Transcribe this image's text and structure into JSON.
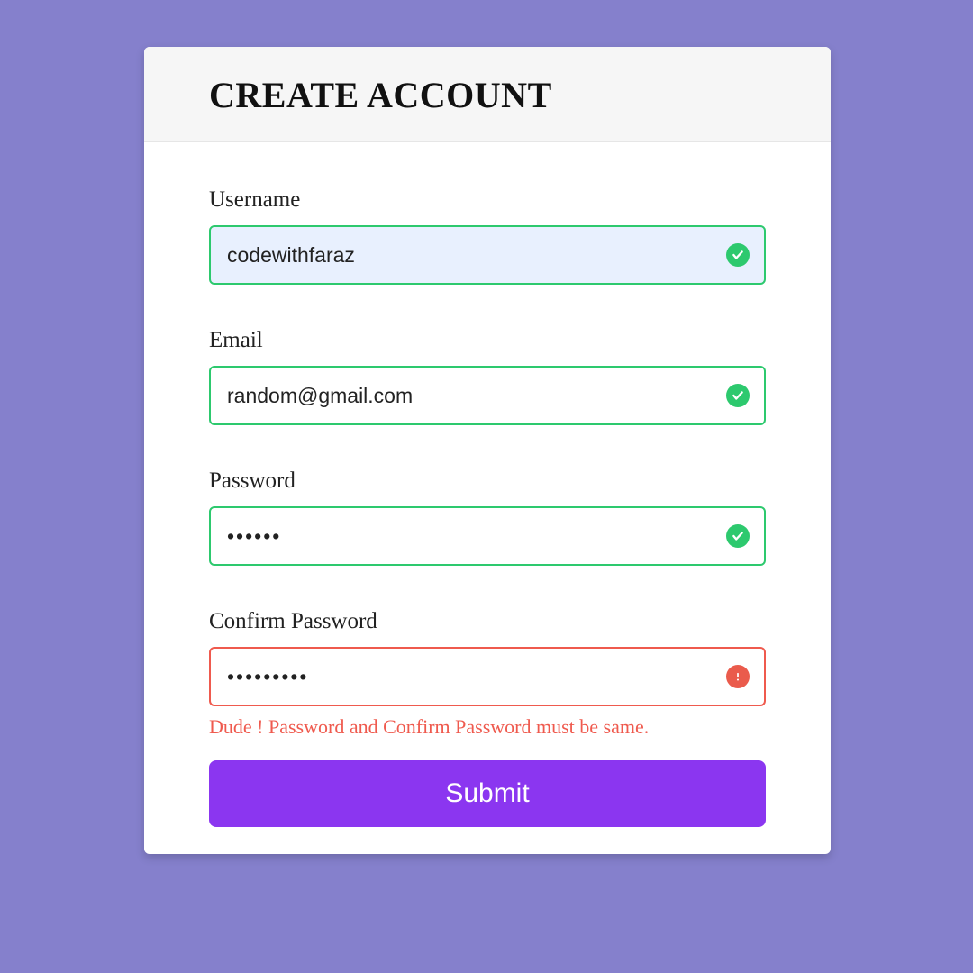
{
  "header": {
    "title": "CREATE ACCOUNT"
  },
  "fields": {
    "username": {
      "label": "Username",
      "value": "codewithfaraz",
      "state": "valid"
    },
    "email": {
      "label": "Email",
      "value": "random@gmail.com",
      "state": "valid"
    },
    "password": {
      "label": "Password",
      "value": "••••••",
      "state": "valid"
    },
    "confirm_password": {
      "label": "Confirm Password",
      "value": "•••••••••",
      "state": "invalid",
      "error": "Dude ! Password and Confirm Password must be same."
    }
  },
  "actions": {
    "submit_label": "Submit"
  },
  "colors": {
    "background": "#8580cc",
    "valid_border": "#2dc96e",
    "invalid_border": "#ef5a4e",
    "button": "#8b36f0"
  }
}
